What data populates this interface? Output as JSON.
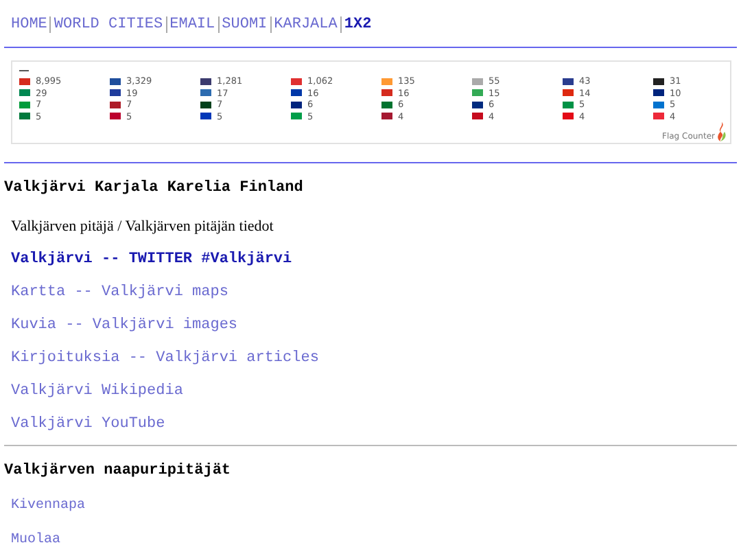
{
  "nav": [
    {
      "label": "HOME",
      "selected": false
    },
    {
      "label": "WORLD CITIES",
      "selected": false
    },
    {
      "label": "EMAIL",
      "selected": false
    },
    {
      "label": "SUOMI",
      "selected": false
    },
    {
      "label": "KARJALA",
      "selected": false
    },
    {
      "label": "1X2",
      "selected": true
    }
  ],
  "flag_counter": {
    "items": [
      {
        "count": "8,995",
        "color": "#d52b1e"
      },
      {
        "count": "3,329",
        "color": "#1f4e9c"
      },
      {
        "count": "1,281",
        "color": "#3c3b6e"
      },
      {
        "count": "1,062",
        "color": "#e03030"
      },
      {
        "count": "135",
        "color": "#ff9933"
      },
      {
        "count": "55",
        "color": "#aaaaaa"
      },
      {
        "count": "43",
        "color": "#2a3d8f"
      },
      {
        "count": "31",
        "color": "#222222"
      },
      {
        "count": "29",
        "color": "#008751"
      },
      {
        "count": "19",
        "color": "#1f3c9c"
      },
      {
        "count": "17",
        "color": "#2d6cb0"
      },
      {
        "count": "16",
        "color": "#0038a8"
      },
      {
        "count": "16",
        "color": "#d52b1e"
      },
      {
        "count": "15",
        "color": "#33aa55"
      },
      {
        "count": "14",
        "color": "#de2910"
      },
      {
        "count": "10",
        "color": "#00247d"
      },
      {
        "count": "7",
        "color": "#009c3b"
      },
      {
        "count": "7",
        "color": "#ae1c28"
      },
      {
        "count": "7",
        "color": "#01411c"
      },
      {
        "count": "6",
        "color": "#00247d"
      },
      {
        "count": "6",
        "color": "#00732f"
      },
      {
        "count": "6",
        "color": "#002b7f"
      },
      {
        "count": "5",
        "color": "#009246"
      },
      {
        "count": "5",
        "color": "#0072ce"
      },
      {
        "count": "5",
        "color": "#007a3d"
      },
      {
        "count": "5",
        "color": "#bc002d"
      },
      {
        "count": "5",
        "color": "#0038b8"
      },
      {
        "count": "5",
        "color": "#009e49"
      },
      {
        "count": "4",
        "color": "#a51931"
      },
      {
        "count": "4",
        "color": "#c60b1e"
      },
      {
        "count": "4",
        "color": "#e30a17"
      },
      {
        "count": "4",
        "color": "#ed2939"
      }
    ],
    "brand": "Flag Counter"
  },
  "title": "Valkjärvi Karjala Karelia Finland",
  "intro": "Valkjärven pitäjä / Valkjärven pitäjän tiedot",
  "links": [
    {
      "label": "Valkjärvi -- TWITTER #Valkjärvi",
      "kind": "featured"
    },
    {
      "label": "Kartta -- Valkjärvi maps",
      "kind": "plain"
    },
    {
      "label": "Kuvia -- Valkjärvi images",
      "kind": "plain"
    },
    {
      "label": "Kirjoituksia -- Valkjärvi articles",
      "kind": "plain"
    },
    {
      "label": "Valkjärvi Wikipedia",
      "kind": "plain"
    },
    {
      "label": "Valkjärvi YouTube",
      "kind": "plain"
    }
  ],
  "neighbours": {
    "title": "Valkjärven naapuripitäjät",
    "links": [
      "Kivennapa",
      "Muolaa"
    ]
  }
}
